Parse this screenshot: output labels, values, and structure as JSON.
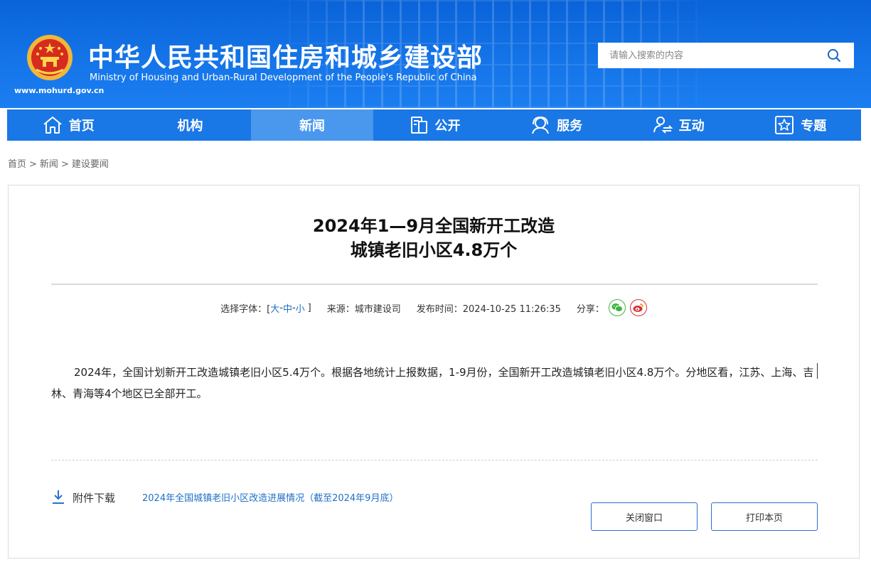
{
  "header": {
    "title_cn": "中华人民共和国住房和城乡建设部",
    "title_en": "Ministry of Housing and Urban-Rural Development of the People's Republic of China",
    "domain": "www.mohurd.gov.cn",
    "search_placeholder": "请输入搜索的内容",
    "brand_color": "#1474e8"
  },
  "nav": {
    "items": [
      {
        "label": "首页",
        "icon": "home-icon"
      },
      {
        "label": "机构",
        "icon": ""
      },
      {
        "label": "新闻",
        "icon": "",
        "active": true
      },
      {
        "label": "公开",
        "icon": "document-icon"
      },
      {
        "label": "服务",
        "icon": "service-icon"
      },
      {
        "label": "互动",
        "icon": "interact-icon"
      },
      {
        "label": "专题",
        "icon": "star-icon"
      }
    ]
  },
  "breadcrumb": [
    "首页",
    ">",
    "新闻",
    ">",
    "建设要闻"
  ],
  "article": {
    "title_line1": "2024年1—9月全国新开工改造",
    "title_line2": "城镇老旧小区4.8万个",
    "meta": {
      "font_label": "选择字体：[",
      "font_large": "大",
      "font_medium": "中",
      "font_small": "小",
      "font_dash": "-",
      "font_close": "]",
      "source": "来源：城市建设司",
      "publish_time": "发布时间：2024-10-25 11:26:35",
      "share_label": "分享："
    },
    "body": "2024年，全国计划新开工改造城镇老旧小区5.4万个。根据各地统计上报数据，1-9月份，全国新开工改造城镇老旧小区4.8万个。分地区看，江苏、上海、吉林、青海等4个地区已全部开工。"
  },
  "attachment": {
    "label": "附件下载",
    "link": "2024年全国城镇老旧小区改造进展情况（截至2024年9月底）"
  },
  "buttons": {
    "close": "关闭窗口",
    "print": "打印本页"
  }
}
